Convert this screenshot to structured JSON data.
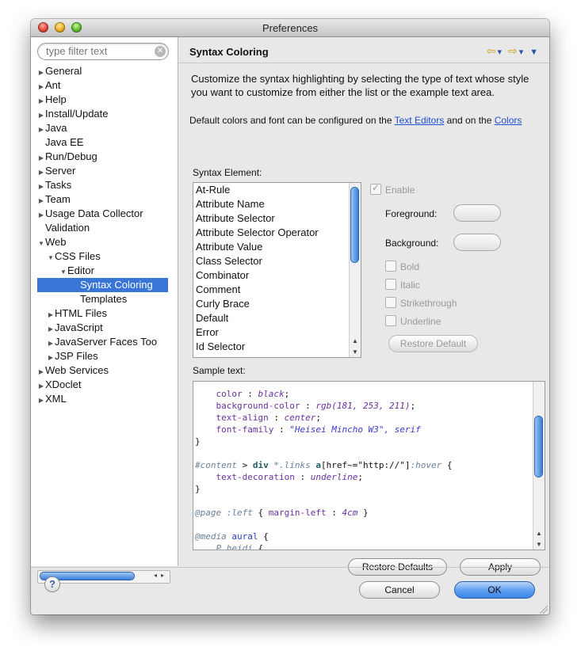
{
  "window": {
    "title": "Preferences"
  },
  "filter": {
    "placeholder": "type filter text"
  },
  "tree": [
    {
      "label": "General",
      "depth": 0,
      "arrow": "▶"
    },
    {
      "label": "Ant",
      "depth": 0,
      "arrow": "▶"
    },
    {
      "label": "Help",
      "depth": 0,
      "arrow": "▶"
    },
    {
      "label": "Install/Update",
      "depth": 0,
      "arrow": "▶"
    },
    {
      "label": "Java",
      "depth": 0,
      "arrow": "▶"
    },
    {
      "label": "Java EE",
      "depth": 0,
      "arrow": ""
    },
    {
      "label": "Run/Debug",
      "depth": 0,
      "arrow": "▶"
    },
    {
      "label": "Server",
      "depth": 0,
      "arrow": "▶"
    },
    {
      "label": "Tasks",
      "depth": 0,
      "arrow": "▶"
    },
    {
      "label": "Team",
      "depth": 0,
      "arrow": "▶"
    },
    {
      "label": "Usage Data Collector",
      "depth": 0,
      "arrow": "▶"
    },
    {
      "label": "Validation",
      "depth": 0,
      "arrow": ""
    },
    {
      "label": "Web",
      "depth": 0,
      "arrow": "▼"
    },
    {
      "label": "CSS Files",
      "depth": 1,
      "arrow": "▼"
    },
    {
      "label": "Editor",
      "depth": 2,
      "arrow": "▼"
    },
    {
      "label": "Syntax Coloring",
      "depth": 3,
      "arrow": "",
      "selected": true
    },
    {
      "label": "Templates",
      "depth": 3,
      "arrow": ""
    },
    {
      "label": "HTML Files",
      "depth": 1,
      "arrow": "▶"
    },
    {
      "label": "JavaScript",
      "depth": 1,
      "arrow": "▶"
    },
    {
      "label": "JavaServer Faces Too",
      "depth": 1,
      "arrow": "▶"
    },
    {
      "label": "JSP Files",
      "depth": 1,
      "arrow": "▶"
    },
    {
      "label": "Web Services",
      "depth": 0,
      "arrow": "▶"
    },
    {
      "label": "XDoclet",
      "depth": 0,
      "arrow": "▶"
    },
    {
      "label": "XML",
      "depth": 0,
      "arrow": "▶"
    }
  ],
  "page": {
    "title": "Syntax Coloring",
    "description": "Customize the syntax highlighting by selecting the type of text whose style you want to customize from either the list or the example text area.",
    "defaults_prefix": "Default colors and font can be configured on the ",
    "text_editors_link": "Text Editors",
    "defaults_mid": " and on the ",
    "colors_link": "Colors",
    "syntax_element_label": "Syntax Element:",
    "sample_label": "Sample text:"
  },
  "syntax_elements": [
    "At-Rule",
    "Attribute Name",
    "Attribute Selector",
    "Attribute Selector Operator",
    "Attribute Value",
    "Class Selector",
    "Combinator",
    "Comment",
    "Curly Brace",
    "Default",
    "Error",
    "Id Selector"
  ],
  "options": {
    "enable": "Enable",
    "foreground": "Foreground:",
    "background": "Background:",
    "bold": "Bold",
    "italic": "Italic",
    "strikethrough": "Strikethrough",
    "underline": "Underline",
    "restore_default": "Restore Default"
  },
  "sample_code": {
    "l1_prop": "color",
    "l1_val": "black",
    "l2_prop": "background-color",
    "l2_val": "rgb(181, 253, 211)",
    "l3_prop": "text-align",
    "l3_val": "center",
    "l4_prop": "font-family",
    "l4_val": "\"Heisei Mincho W3\", serif",
    "brace_close": "}",
    "l6_sel_id": "#content",
    "l6_comb": ">",
    "l6_elem": "div",
    "l6_cls": "*.links",
    "l6_attr_el": "a",
    "l6_attr": "[href~=\"http://\"]",
    "l6_pseudo": ":hover",
    "l7_prop": "text-decoration",
    "l7_val": "underline",
    "l9_rule": "@page",
    "l9_pseudo": ":left",
    "l9_prop": "margin-left",
    "l9_val": "4cm",
    "l11_rule": "@media",
    "l11_val": "aural",
    "l12_sel": "P.heidi"
  },
  "buttons": {
    "restore_defaults": "Restore Defaults",
    "apply": "Apply",
    "cancel": "Cancel",
    "ok": "OK",
    "help": "?"
  }
}
